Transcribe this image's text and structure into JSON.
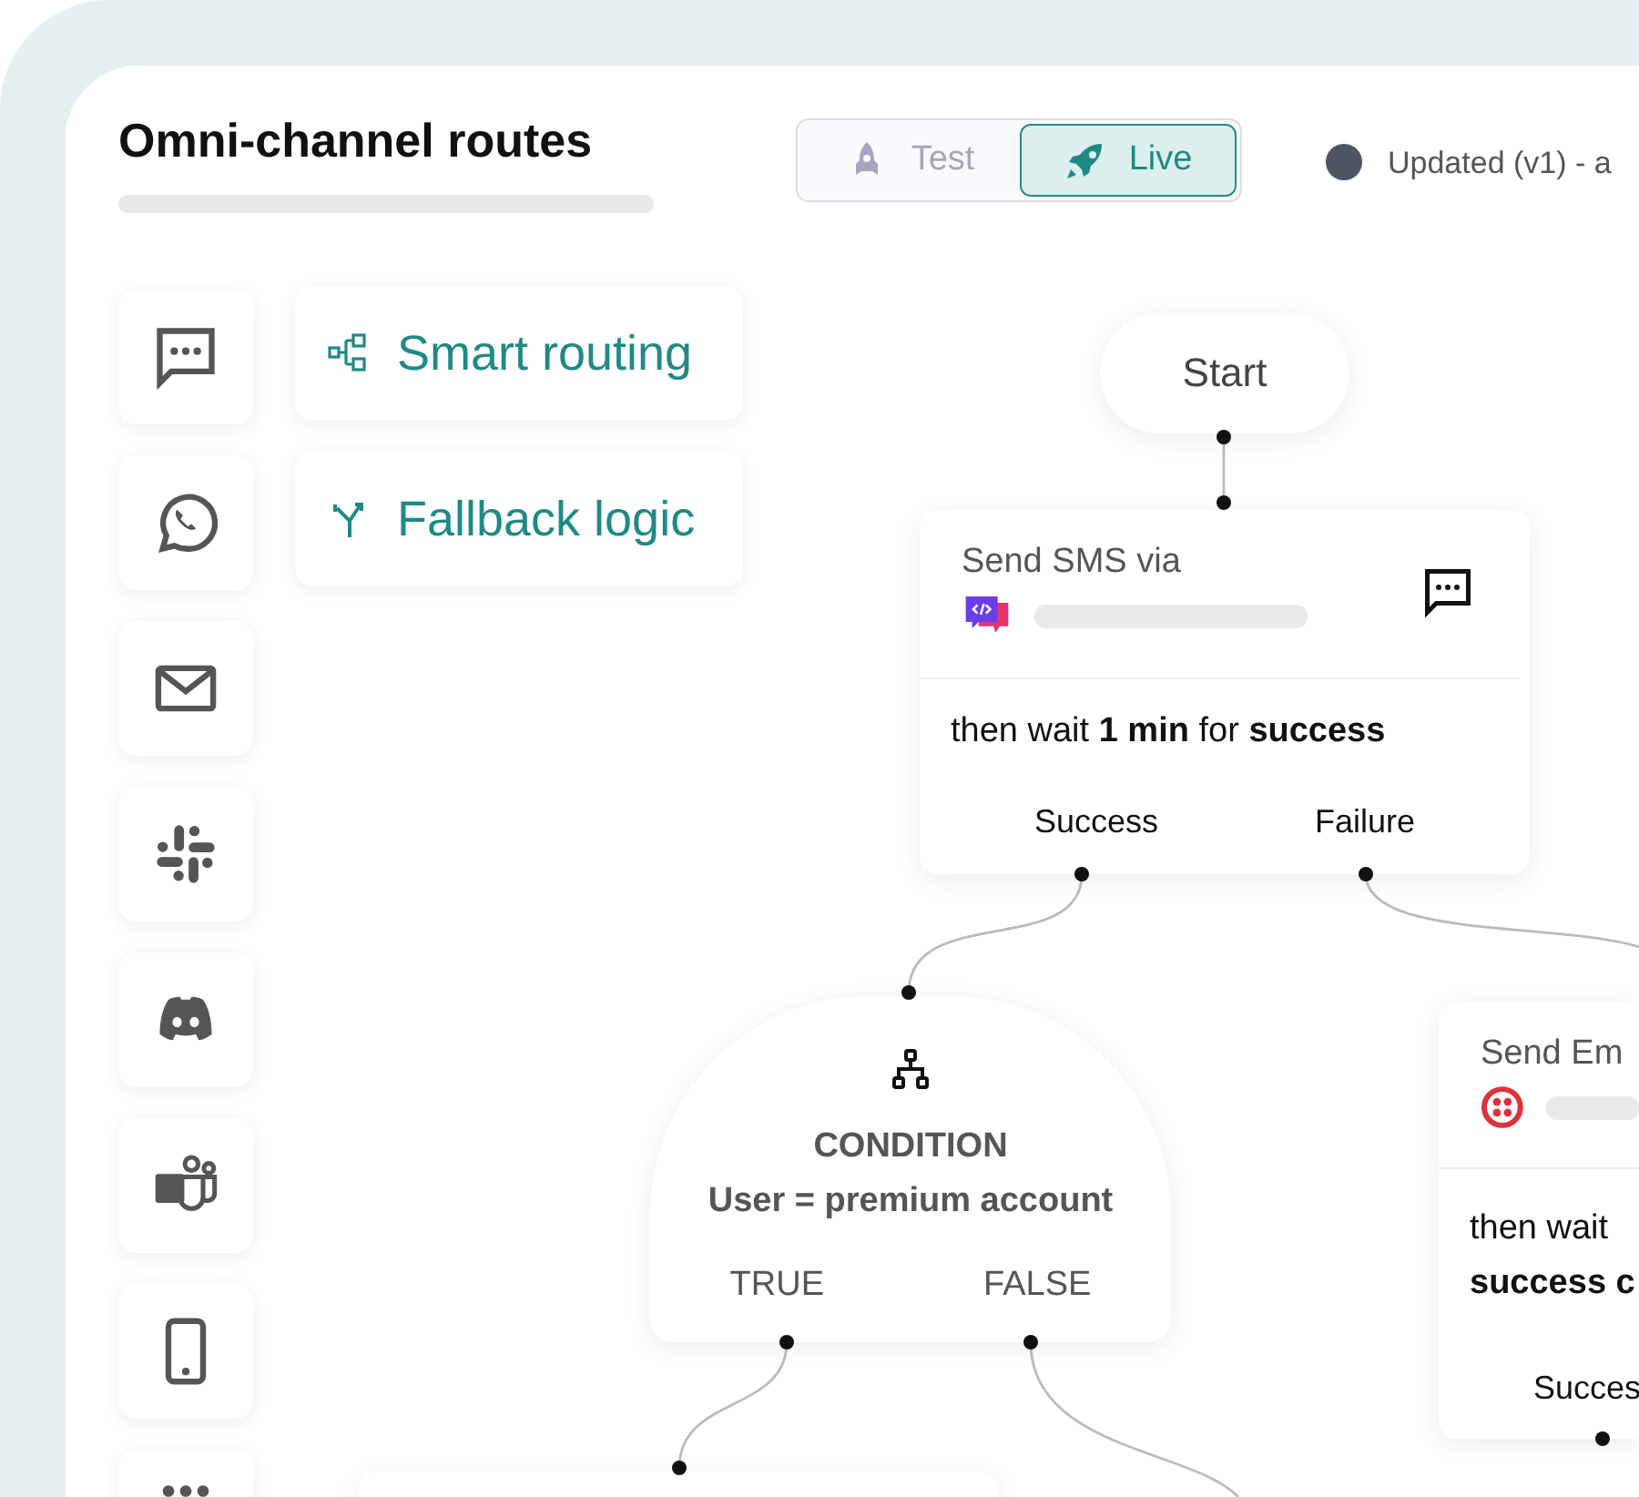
{
  "header": {
    "title": "Omni-channel routes"
  },
  "mode_toggle": [
    {
      "label": "Test",
      "selected": false
    },
    {
      "label": "Live",
      "selected": true
    }
  ],
  "version_status": "Updated (v1) - a",
  "channels": [
    {
      "kind": "sms"
    },
    {
      "kind": "whatsapp"
    },
    {
      "kind": "email"
    },
    {
      "kind": "slack"
    },
    {
      "kind": "discord"
    },
    {
      "kind": "teams"
    },
    {
      "kind": "mobile"
    },
    {
      "kind": "more"
    }
  ],
  "features": [
    {
      "kind": "routing",
      "label": "Smart routing"
    },
    {
      "kind": "fallback",
      "label": "Fallback logic"
    }
  ],
  "flow": {
    "start": "Start",
    "sms_node": {
      "title": "Send SMS via",
      "wait": "then wait **1 min** for **success**",
      "outcomes": [
        "Success",
        "Failure"
      ]
    },
    "condition": {
      "label": "CONDITION",
      "rule": "User = premium account",
      "outcomes": [
        "TRUE",
        "FALSE"
      ]
    },
    "email_node": {
      "title": "Send Em",
      "wait_line_1": "then wait",
      "wait_line_2": "success c",
      "outcomes": [
        "Succes"
      ]
    }
  }
}
